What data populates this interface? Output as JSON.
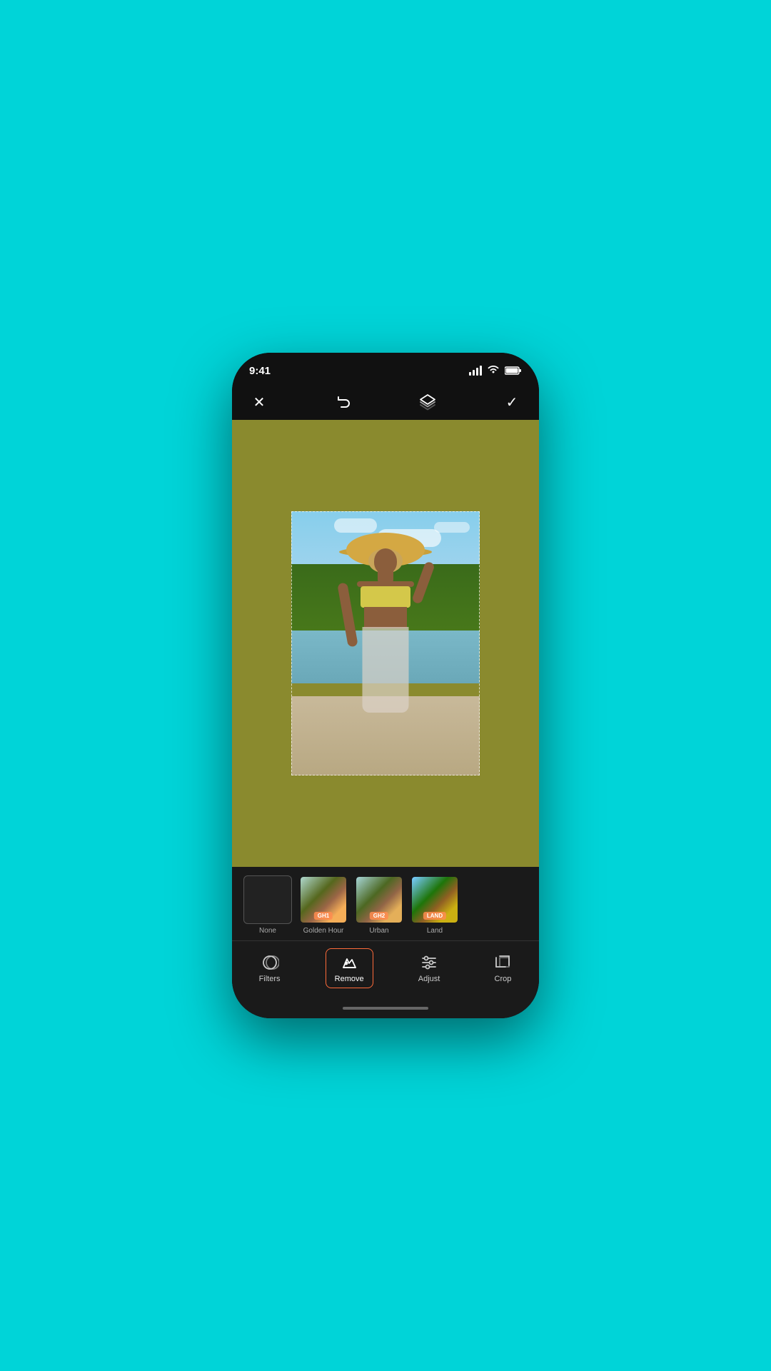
{
  "phone": {
    "status_bar": {
      "time": "9:41",
      "signal_label": "signal",
      "wifi_label": "wifi",
      "battery_label": "battery"
    },
    "toolbar": {
      "close_label": "✕",
      "undo_label": "↩",
      "layers_label": "layers",
      "confirm_label": "✓"
    },
    "filters": {
      "none_label": "None",
      "items": [
        {
          "id": "none",
          "label": "",
          "badge": "",
          "active": false
        },
        {
          "id": "gh1",
          "label": "Golden Hour",
          "badge": "GH1",
          "active": false
        },
        {
          "id": "gh2",
          "label": "Urban",
          "badge": "GH2",
          "active": false
        },
        {
          "id": "land",
          "label": "Land",
          "badge": "LAND",
          "active": false
        }
      ]
    },
    "tools": [
      {
        "id": "filters",
        "label": "Filters",
        "icon": "filters",
        "active": false
      },
      {
        "id": "remove",
        "label": "Remove",
        "icon": "eraser",
        "active": true
      },
      {
        "id": "adjust",
        "label": "Adjust",
        "icon": "sliders",
        "active": false
      },
      {
        "id": "crop",
        "label": "Crop",
        "icon": "crop",
        "active": false
      }
    ]
  }
}
